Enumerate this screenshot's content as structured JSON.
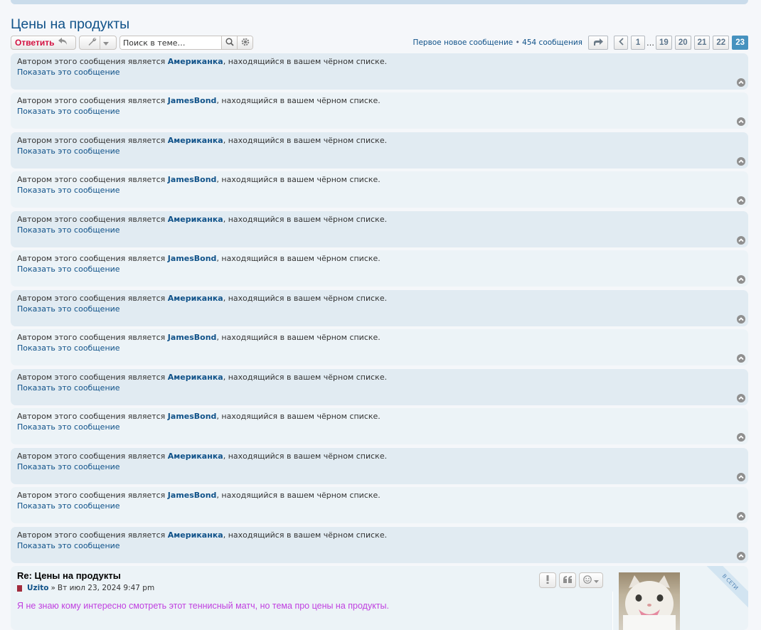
{
  "topic": {
    "title": "Цены на продукты"
  },
  "toolbar": {
    "reply_label": "Ответить",
    "search_placeholder": "Поиск в теме…"
  },
  "pagination": {
    "first_new": "Первое новое сообщение",
    "separator": "•",
    "count": "454 сообщения",
    "pages": [
      "1",
      "…",
      "19",
      "20",
      "21",
      "22",
      "23"
    ],
    "current": "23"
  },
  "blocked_posts": [
    {
      "prefix": "Автором этого сообщения является ",
      "author": "Американка",
      "suffix": ", находящийся в вашем чёрном списке.",
      "show": "Показать это сообщение"
    },
    {
      "prefix": "Автором этого сообщения является ",
      "author": "JamesBond",
      "suffix": ", находящийся в вашем чёрном списке.",
      "show": "Показать это сообщение"
    },
    {
      "prefix": "Автором этого сообщения является ",
      "author": "Американка",
      "suffix": ", находящийся в вашем чёрном списке.",
      "show": "Показать это сообщение"
    },
    {
      "prefix": "Автором этого сообщения является ",
      "author": "JamesBond",
      "suffix": ", находящийся в вашем чёрном списке.",
      "show": "Показать это сообщение"
    },
    {
      "prefix": "Автором этого сообщения является ",
      "author": "Американка",
      "suffix": ", находящийся в вашем чёрном списке.",
      "show": "Показать это сообщение"
    },
    {
      "prefix": "Автором этого сообщения является ",
      "author": "JamesBond",
      "suffix": ", находящийся в вашем чёрном списке.",
      "show": "Показать это сообщение"
    },
    {
      "prefix": "Автором этого сообщения является ",
      "author": "Американка",
      "suffix": ", находящийся в вашем чёрном списке.",
      "show": "Показать это сообщение"
    },
    {
      "prefix": "Автором этого сообщения является ",
      "author": "JamesBond",
      "suffix": ", находящийся в вашем чёрном списке.",
      "show": "Показать это сообщение"
    },
    {
      "prefix": "Автором этого сообщения является ",
      "author": "Американка",
      "suffix": ", находящийся в вашем чёрном списке.",
      "show": "Показать это сообщение"
    },
    {
      "prefix": "Автором этого сообщения является ",
      "author": "JamesBond",
      "suffix": ", находящийся в вашем чёрном списке.",
      "show": "Показать это сообщение"
    },
    {
      "prefix": "Автором этого сообщения является ",
      "author": "Американка",
      "suffix": ", находящийся в вашем чёрном списке.",
      "show": "Показать это сообщение"
    },
    {
      "prefix": "Автором этого сообщения является ",
      "author": "JamesBond",
      "suffix": ", находящийся в вашем чёрном списке.",
      "show": "Показать это сообщение"
    },
    {
      "prefix": "Автором этого сообщения является ",
      "author": "Американка",
      "suffix": ", находящийся в вашем чёрном списке.",
      "show": "Показать это сообщение"
    }
  ],
  "post": {
    "title": "Re: Цены на продукты",
    "author": "Uzito",
    "separator": "»",
    "date": "Вт июл 23, 2024 9:47 pm",
    "content": "Я не знаю кому интересно смотреть этот теннисный матч, но тема про цены на продукты.",
    "online_label": "В СЕТИ"
  },
  "colors": {
    "link": "#105289",
    "reply": "#d31141",
    "active_page": "#4692bf",
    "post_text": "#c040e0"
  }
}
